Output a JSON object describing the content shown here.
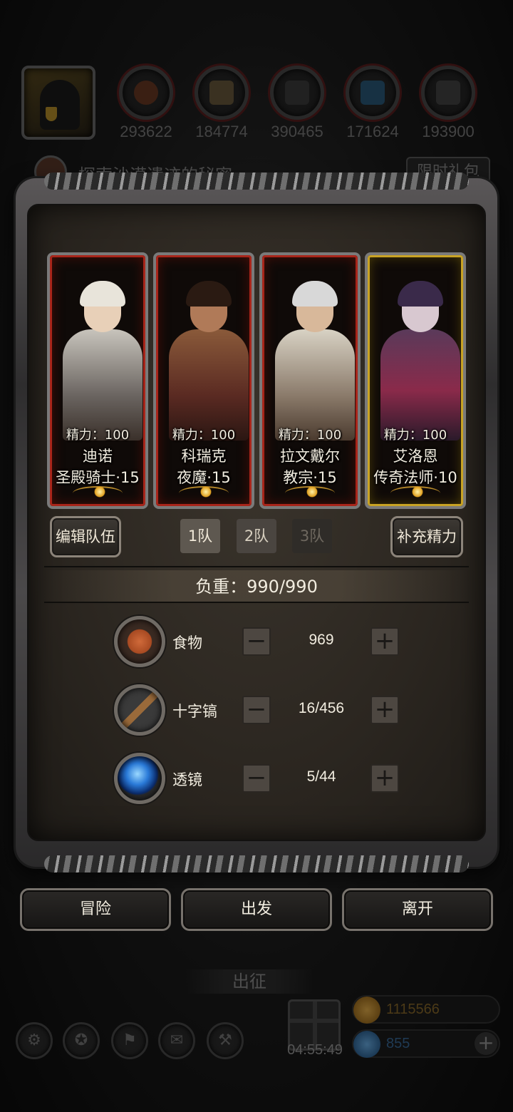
{
  "hud": {
    "resources": [
      {
        "icon": "meat-icon",
        "value": "293622"
      },
      {
        "icon": "wood-icon",
        "value": "184774"
      },
      {
        "icon": "iron-icon",
        "value": "390465"
      },
      {
        "icon": "crystal-icon",
        "value": "171624"
      },
      {
        "icon": "stone-icon",
        "value": "193900"
      }
    ],
    "quest_text": "探索沙漠遗迹的秘密",
    "limited_pack_label": "限时礼包"
  },
  "modal": {
    "heroes": [
      {
        "stamina": "精力：100",
        "name": "迪诺",
        "class_level": "圣殿骑士·15",
        "rank_color": "#a8251a"
      },
      {
        "stamina": "精力：100",
        "name": "科瑞克",
        "class_level": "夜魔·15",
        "rank_color": "#a8251a"
      },
      {
        "stamina": "精力：100",
        "name": "拉文戴尔",
        "class_level": "教宗·15",
        "rank_color": "#a8251a"
      },
      {
        "stamina": "精力：100",
        "name": "艾洛恩",
        "class_level": "传奇法师·10",
        "rank_color": "#c9a324"
      }
    ],
    "edit_team_label": "编辑队伍",
    "team_tabs": [
      "1队",
      "2队",
      "3队"
    ],
    "active_team": "1队",
    "refill_stamina_label": "补充精力",
    "load_label": "负重：990/990",
    "supplies": [
      {
        "icon": "food-icon",
        "label": "食物",
        "quantity": "969"
      },
      {
        "icon": "pickaxe-icon",
        "label": "十字镐",
        "quantity": "16/456"
      },
      {
        "icon": "lens-icon",
        "label": "透镜",
        "quantity": "5/44"
      }
    ],
    "minus_glyph": "−",
    "plus_glyph": "+"
  },
  "actions": {
    "adventure_label": "冒险",
    "depart_label": "出发",
    "leave_label": "离开"
  },
  "bottom": {
    "expedition_label": "出征",
    "gift_timer": "04:55:49",
    "gold_amount": "1115566",
    "gem_amount": "855",
    "plus_glyph": "+"
  },
  "colors": {
    "rank_red": "#a8251a",
    "rank_gold": "#c9a324",
    "panel_bg": "#2b2620",
    "text_primary": "#f2ede0"
  }
}
